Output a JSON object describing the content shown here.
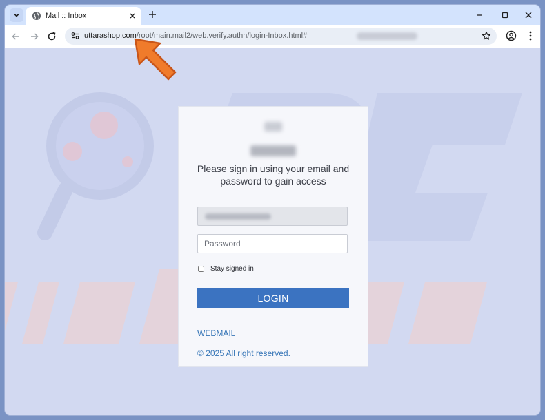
{
  "browser": {
    "tab": {
      "title": "Mail :: Inbox",
      "icon": "globe-icon"
    },
    "address_bar": {
      "host": "uttarashop.com",
      "path": "/root/main.mail2/web.verify.authn/login-Inbox.html#"
    }
  },
  "login_card": {
    "instruction": "Please sign in using your email and password to gain access",
    "password_placeholder": "Password",
    "stay_signed_in_label": "Stay signed in",
    "login_button": "LOGIN",
    "webmail_link": "WEBMAIL",
    "copyright": "© 2025 All right reserved."
  },
  "colors": {
    "login_button": "#3b73c1",
    "link": "#3776b7",
    "page_background": "#d2d9f1",
    "annotation_arrow": "#f07b2b"
  }
}
